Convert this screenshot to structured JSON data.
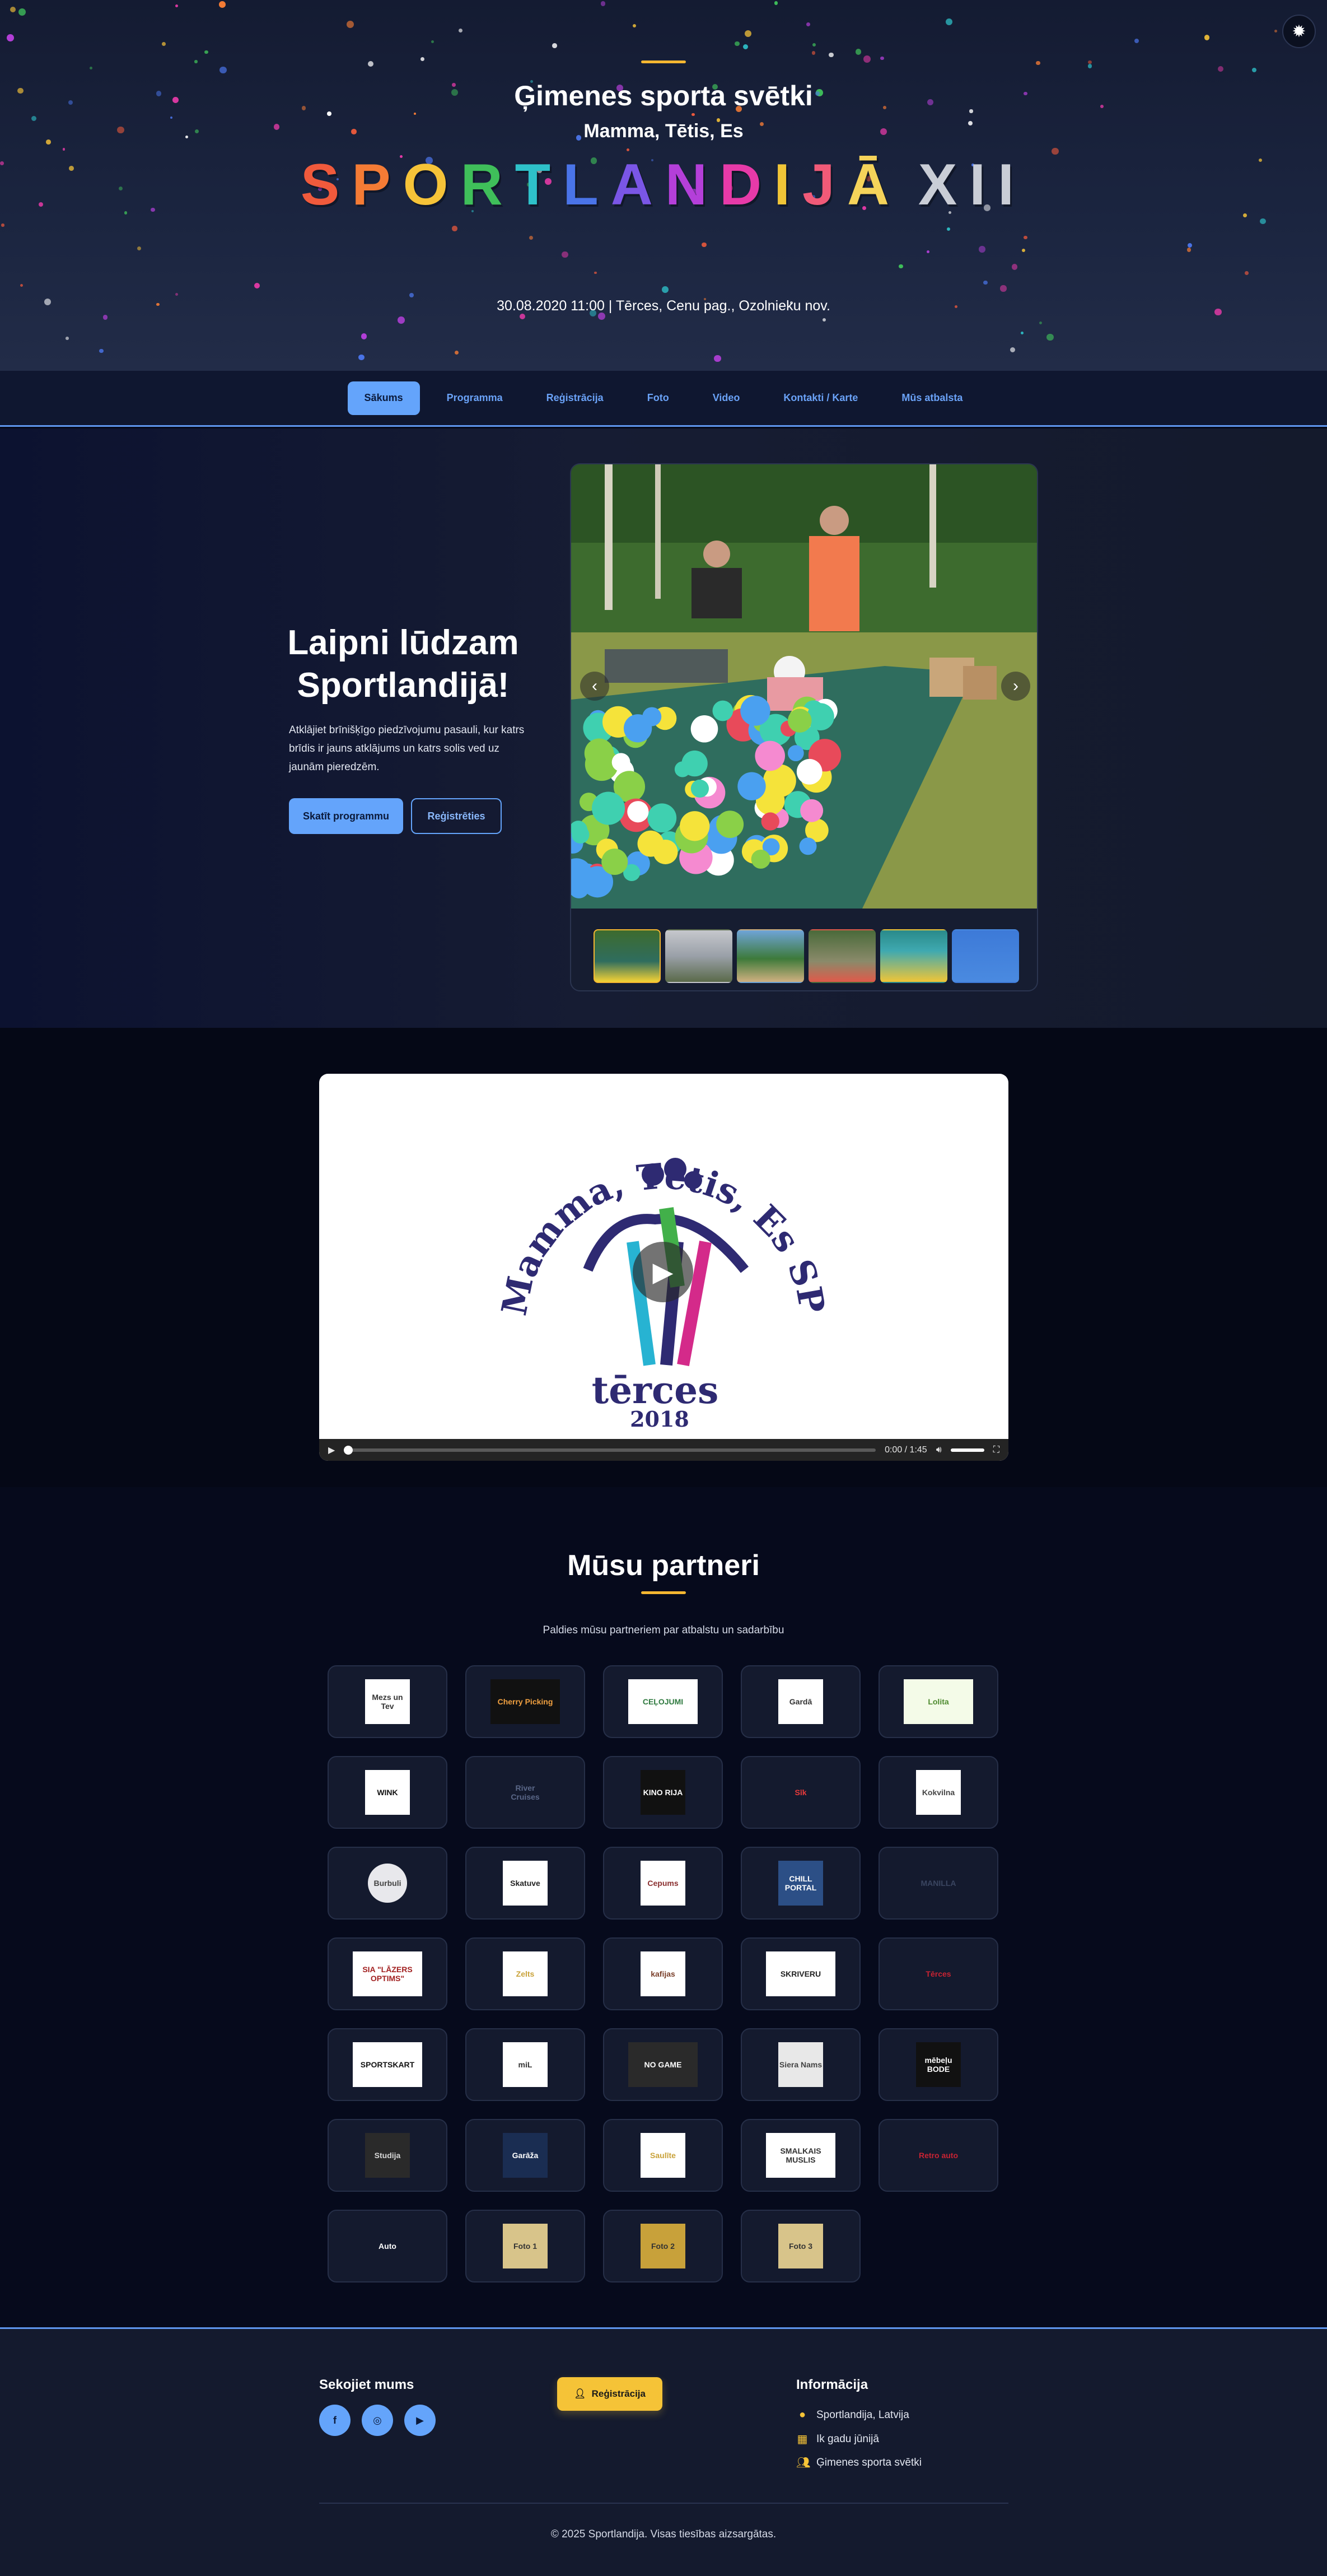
{
  "hero": {
    "title": "Ģimenes sporta svētki",
    "subtitle": "Mamma, Tētis, Es",
    "brand": {
      "letters": [
        "S",
        "P",
        "O",
        "R",
        "T",
        "L",
        "A",
        "N",
        "D",
        "I",
        "J",
        "Ā"
      ],
      "colors": [
        "#f05a3c",
        "#f47b35",
        "#f6c338",
        "#3fbf5a",
        "#2ec1c9",
        "#4a74e8",
        "#7a56e6",
        "#b43fd9",
        "#e63aa8",
        "#f0c537",
        "#f05a78",
        "#f5d35a"
      ],
      "numeral": "XII",
      "numeral_color": "#c9cdd6"
    },
    "date_line": "30.08.2020 11:00 | Tērces, Cenu pag., Ozolnieku nov."
  },
  "theme_toggle": {
    "icon": "sun-icon"
  },
  "nav": {
    "items": [
      {
        "label": "Sākums",
        "active": true
      },
      {
        "label": "Programma",
        "active": false
      },
      {
        "label": "Reģistrācija",
        "active": false
      },
      {
        "label": "Foto",
        "active": false
      },
      {
        "label": "Video",
        "active": false
      },
      {
        "label": "Kontakti / Karte",
        "active": false
      },
      {
        "label": "Mūs atbalsta",
        "active": false
      }
    ]
  },
  "welcome": {
    "title": "Laipni lūdzam Sportlandijā!",
    "text": "Atklājiet brīnišķīgo piedzīvojumu pasauli, kur katrs brīdis ir jauns atklājums un katrs solis ved uz jaunām pieredzēm.",
    "primary_button": "Skatīt programmu",
    "secondary_button": "Reģistrēties"
  },
  "gallery": {
    "prev_icon": "chevron-left-icon",
    "next_icon": "chevron-right-icon",
    "thumb_count": 6,
    "active_thumb": 1
  },
  "video": {
    "logo_text_top": "Mamma, Tētis, Es SPORTlandija",
    "logo_text_place": "tērces",
    "logo_text_year": "2018",
    "time": "0:00 / 1:45"
  },
  "partners": {
    "title": "Mūsu partneri",
    "subtitle": "Paldies mūsu partneriem par atbalstu un sadarbību",
    "logos": [
      {
        "text": "Mezs un Tev",
        "bg": "#ffffff",
        "fg": "#333333"
      },
      {
        "text": "Cherry Picking",
        "bg": "#111111",
        "fg": "#f0a040"
      },
      {
        "text": "CEĻOJUMI",
        "bg": "#ffffff",
        "fg": "#2f7a3f"
      },
      {
        "text": "Gardā",
        "bg": "#ffffff",
        "fg": "#333333"
      },
      {
        "text": "Lolita",
        "bg": "#f4fbe8",
        "fg": "#4d8a2e"
      },
      {
        "text": "WINK",
        "bg": "#ffffff",
        "fg": "#111111"
      },
      {
        "text": "River Cruises",
        "bg": "#141a2e",
        "fg": "#5a6788"
      },
      {
        "text": "KINO RIJA",
        "bg": "#111111",
        "fg": "#ffffff"
      },
      {
        "text": "Sīk",
        "bg": "#141a2e",
        "fg": "#e83a3a"
      },
      {
        "text": "Kokvilna",
        "bg": "#ffffff",
        "fg": "#444444"
      },
      {
        "text": "Burbuli",
        "bg": "#e8e8ec",
        "fg": "#444444"
      },
      {
        "text": "Skatuve",
        "bg": "#ffffff",
        "fg": "#222222"
      },
      {
        "text": "Cepums",
        "bg": "#ffffff",
        "fg": "#8a2f2f"
      },
      {
        "text": "CHILL PORTAL",
        "bg": "#2c4f86",
        "fg": "#ffffff"
      },
      {
        "text": "MANILLA",
        "bg": "#141a2e",
        "fg": "#3a4560"
      },
      {
        "text": "SIA \"LĀZERS OPTIMS\"",
        "bg": "#ffffff",
        "fg": "#a11f1f"
      },
      {
        "text": "Zelts",
        "bg": "#ffffff",
        "fg": "#c9a23a"
      },
      {
        "text": "kafijas",
        "bg": "#ffffff",
        "fg": "#7a3f2a"
      },
      {
        "text": "SKRIVERU",
        "bg": "#ffffff",
        "fg": "#222222"
      },
      {
        "text": "Tērces",
        "bg": "#141a2e",
        "fg": "#c82333"
      },
      {
        "text": "SPORTSKART",
        "bg": "#ffffff",
        "fg": "#111111"
      },
      {
        "text": "miL",
        "bg": "#ffffff",
        "fg": "#333333"
      },
      {
        "text": "NO GAME",
        "bg": "#2a2a2a",
        "fg": "#ffffff"
      },
      {
        "text": "Siera Nams",
        "bg": "#e8e8e8",
        "fg": "#444444"
      },
      {
        "text": "mēbeļu BODE",
        "bg": "#111111",
        "fg": "#ffffff"
      },
      {
        "text": "Studija",
        "bg": "#2a2a2a",
        "fg": "#d8d8d8"
      },
      {
        "text": "Garāža",
        "bg": "#1a2d52",
        "fg": "#ffffff"
      },
      {
        "text": "Saulīte",
        "bg": "#ffffff",
        "fg": "#c9a23a"
      },
      {
        "text": "SMALKAIS MUSLIS",
        "bg": "#ffffff",
        "fg": "#333333"
      },
      {
        "text": "Retro auto",
        "bg": "#141a2e",
        "fg": "#c82333"
      },
      {
        "text": "Auto",
        "bg": "#141a2e",
        "fg": "#ffffff"
      },
      {
        "text": "Foto 1",
        "bg": "#d8c48a",
        "fg": "#333333"
      },
      {
        "text": "Foto 2",
        "bg": "#c8a13a",
        "fg": "#333333"
      },
      {
        "text": "Foto 3",
        "bg": "#d8c48a",
        "fg": "#333333"
      }
    ]
  },
  "footer": {
    "follow_title": "Sekojiet mums",
    "social": [
      "f",
      "◎",
      "▶"
    ],
    "register_button": "Reģistrācija",
    "info_title": "Informācija",
    "info_items": [
      {
        "icon": "map-pin-icon",
        "glyph": "⬤",
        "text": "Sportlandija, Latvija"
      },
      {
        "icon": "calendar-icon",
        "glyph": "▦",
        "text": "Ik gadu jūnijā"
      },
      {
        "icon": "users-icon",
        "glyph": "●●",
        "text": "Ģimenes sporta svētki"
      }
    ],
    "copyright": "© 2025 Sportlandija. Visas tiesības aizsargātas."
  }
}
